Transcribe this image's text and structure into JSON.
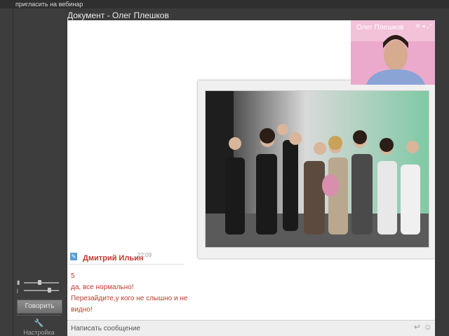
{
  "topbar": {
    "invite_label": "пригласить на вебинар"
  },
  "document": {
    "title": "Документ - Олег Плешков"
  },
  "video": {
    "name": "Олег Плешков",
    "icons": [
      "gear-icon",
      "speaker-icon",
      "fullscreen-icon"
    ]
  },
  "sidebar": {
    "mic_level": 0.75,
    "speaker_level": 0.45,
    "talk_button": "Говорить",
    "settings_label": "Настройка"
  },
  "chat": {
    "author": "Дмитрий Ильин",
    "time": "22:09",
    "messages": [
      "5",
      "да, все нормально!",
      "Перезайдите,у кого не слышно и не",
      "видно!"
    ]
  },
  "input": {
    "placeholder": "Написать сообщение"
  },
  "colors": {
    "chat_red": "#c0392b",
    "video_bg": "#e8a0c4"
  }
}
